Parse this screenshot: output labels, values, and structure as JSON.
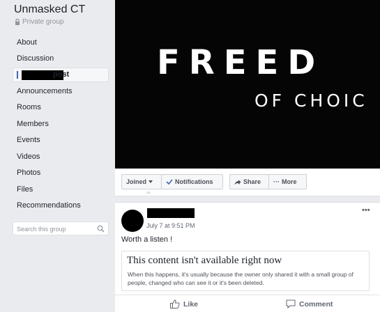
{
  "sidebar": {
    "group_name": "Unmasked CT",
    "privacy_label": "Private group",
    "items": [
      {
        "label": "About"
      },
      {
        "label": "Discussion"
      },
      {
        "label": "post"
      },
      {
        "label": "Announcements"
      },
      {
        "label": "Rooms"
      },
      {
        "label": "Members"
      },
      {
        "label": "Events"
      },
      {
        "label": "Videos"
      },
      {
        "label": "Photos"
      },
      {
        "label": "Files"
      },
      {
        "label": "Recommendations"
      }
    ],
    "search_placeholder": "Search this group"
  },
  "cover": {
    "line1": "FREED",
    "line2": "OF CHOIC"
  },
  "actions": {
    "joined": "Joined",
    "notifications": "Notifications",
    "share": "Share",
    "more": "More"
  },
  "post": {
    "timestamp": "July 7 at 9:51 PM",
    "text": "Worth a listen !",
    "unavailable_title": "This content isn't available right now",
    "unavailable_body": "When this happens, it's usually because the owner only shared it with a small group of people, changed who can see it or it's been deleted.",
    "like_label": "Like",
    "comment_label": "Comment"
  },
  "colors": {
    "accent": "#4267b2",
    "background": "#e9ebee",
    "cover": "#050505"
  }
}
